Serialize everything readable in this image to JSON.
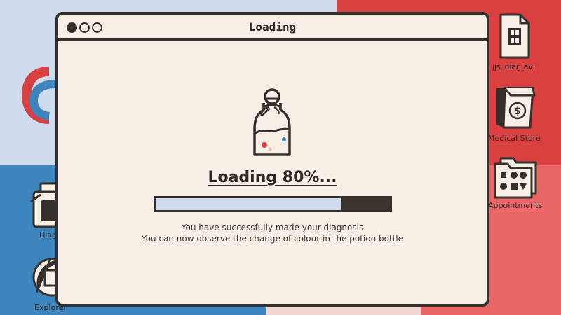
{
  "window": {
    "title": "Loading",
    "heading": "Loading 80%...",
    "progress_fraction": 0.8,
    "message_line1": "You have successfully made your diagnosis",
    "message_line2": "You can now observe the change of colour in the potion bottle",
    "icon": "potion-bottle-icon"
  },
  "desktop": {
    "icons": [
      {
        "label": "jjs_diag.avi",
        "icon": "video-file-icon"
      },
      {
        "label": "Medical Store",
        "icon": "store-bag-icon"
      },
      {
        "label": "Appointments",
        "icon": "appointments-folder-icon"
      },
      {
        "label": "Diagn",
        "icon": "diagnosis-jar-icon"
      },
      {
        "label": "Explorer",
        "icon": "explorer-globe-icon"
      }
    ]
  },
  "colors": {
    "window_bg": "#f7efe5",
    "outline": "#35302c",
    "progress_fill": "#cfdced",
    "desktop_red": "#d94141",
    "desktop_blue": "#3f85bd",
    "desktop_light_blue": "#cfdced",
    "desktop_pink": "#f2d6d4"
  }
}
